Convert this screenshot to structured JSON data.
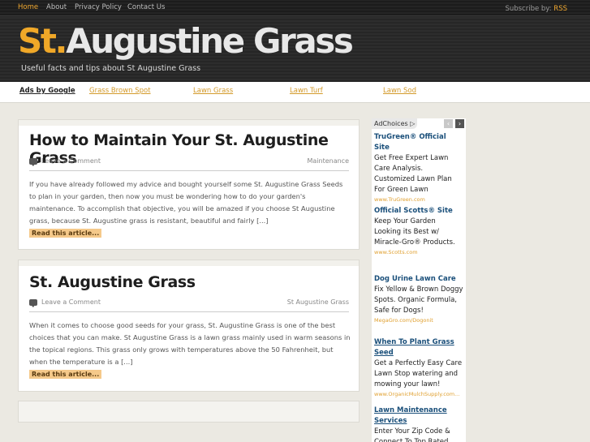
{
  "topnav": {
    "items": [
      "Home",
      "About",
      "Privacy Policy",
      "Contact Us"
    ],
    "subscribe_label": "Subscribe by:",
    "rss_label": "RSS"
  },
  "header": {
    "logo_st": "St.",
    "logo_rest": "Augustine Grass",
    "tagline": "Useful facts and tips about St Augustine Grass"
  },
  "adbar": {
    "label": "Ads by Google",
    "links": [
      "Grass Brown Spot",
      "Lawn Grass",
      "Lawn Turf",
      "Lawn Sod"
    ]
  },
  "posts": [
    {
      "title": "How to Maintain Your St. Augustine Grass",
      "comment": "Leave a Comment",
      "category": "Maintenance",
      "excerpt": "If you have already followed my advice and bought yourself some St. Augustine Grass Seeds to plan in your garden, then now you must be wondering how to do your garden's maintenance. To accomplish that objective, you will be amazed if you choose St Augustine grass, because St. Augustine grass is resistant, beautiful and fairly [...]",
      "readmore": "Read this article..."
    },
    {
      "title": "St. Augustine Grass",
      "comment": "Leave a Comment",
      "category": "St Augustine Grass",
      "excerpt": "When it comes to choose good seeds for your grass, St. Augustine Grass is one of the best choices that you can make. St Augustine Grass is a lawn grass mainly used in warm seasons in the topical regions. This grass only grows with temperatures above the 50 Fahrenheit, but when the temperature is a [...]",
      "readmore": "Read this article..."
    }
  ],
  "sidebar_ad": {
    "adchoices": "AdChoices",
    "prev": "‹",
    "next": "›",
    "items": [
      {
        "title": "TruGreen® Official Site",
        "text": "Get Free Expert Lawn Care Analysis. Customized Lawn Plan For Green Lawn",
        "url": "www.TruGreen.com"
      },
      {
        "title": "Official Scotts® Site",
        "text": "Keep Your Garden Looking its Best w/ Miracle-Gro® Products.",
        "url": "www.Scotts.com"
      },
      {
        "title": "Dog Urine Lawn Care",
        "text": "Fix Yellow & Brown Doggy Spots. Organic Formula, Safe for Dogs!",
        "url": "MegaGro.com/Dogonit"
      },
      {
        "title": "When To Plant Grass Seed",
        "text": "Get a Perfectly Easy Care Lawn Stop watering and mowing your lawn!",
        "url": "www.OrganicMulchSupply.com..."
      },
      {
        "title": "Lawn Maintenance Services",
        "text": "Enter Your Zip Code & Connect To Top Rated",
        "url": ""
      }
    ]
  },
  "colors": {
    "accent": "#f0a828",
    "link": "#d39a2a",
    "ad_title": "#1a4f7a"
  }
}
